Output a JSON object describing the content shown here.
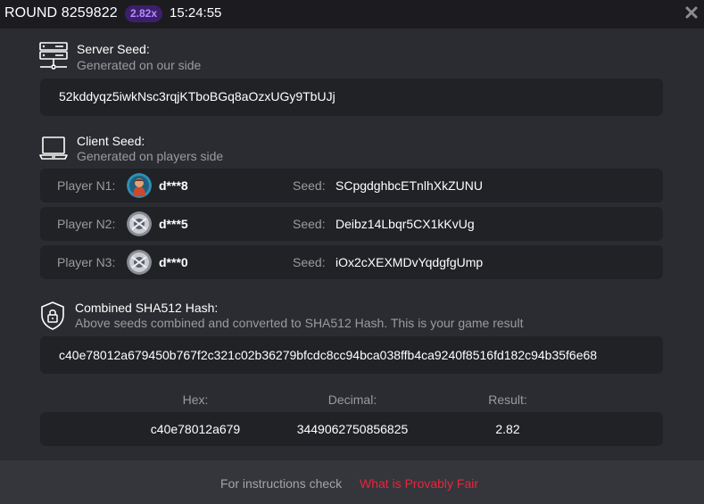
{
  "header": {
    "round_title": "ROUND 8259822",
    "multiplier": "2.82x",
    "time": "15:24:55",
    "close_icon": "close-icon"
  },
  "server_seed": {
    "icon": "server-icon",
    "title": "Server Seed:",
    "subtitle": "Generated on our side",
    "value": "52kddyqz5iwkNsc3rqjKTboBGq8aOzxUGy9TbUJj"
  },
  "client_seed": {
    "icon": "laptop-icon",
    "title": "Client Seed:",
    "subtitle": "Generated on players side",
    "seed_label": "Seed:",
    "players": [
      {
        "label": "Player N1:",
        "name": "d***8",
        "seed": "SCpgdghbcETnlhXkZUNU",
        "avatar": "player-avatar-1"
      },
      {
        "label": "Player N2:",
        "name": "d***5",
        "seed": "Deibz14Lbqr5CX1kKvUg",
        "avatar": "player-avatar-2"
      },
      {
        "label": "Player N3:",
        "name": "d***0",
        "seed": "iOx2cXEXMDvYqdgfgUmp",
        "avatar": "player-avatar-3"
      }
    ]
  },
  "combined_hash": {
    "icon": "shield-lock-icon",
    "title": "Combined SHA512 Hash:",
    "subtitle": "Above seeds combined and converted to SHA512 Hash. This is your game result",
    "value": "c40e78012a679450b767f2c321c02b36279bfcdc8cc94bca038ffb4ca9240f8516fd182c94b35f6e68"
  },
  "result": {
    "hex_label": "Hex:",
    "decimal_label": "Decimal:",
    "result_label": "Result:",
    "hex_value": "c40e78012a679",
    "decimal_value": "3449062750856825",
    "result_value": "2.82"
  },
  "footer": {
    "text": "For instructions check",
    "link": "What is Provably Fair"
  },
  "colors": {
    "background": "#2b2c31",
    "header": "#1c1c20",
    "box": "#212226",
    "footer": "#35363b",
    "muted_text": "#9a9ba0",
    "badge_bg": "#3c1f6b",
    "badge_text": "#b48cff",
    "link": "#e8253c"
  }
}
